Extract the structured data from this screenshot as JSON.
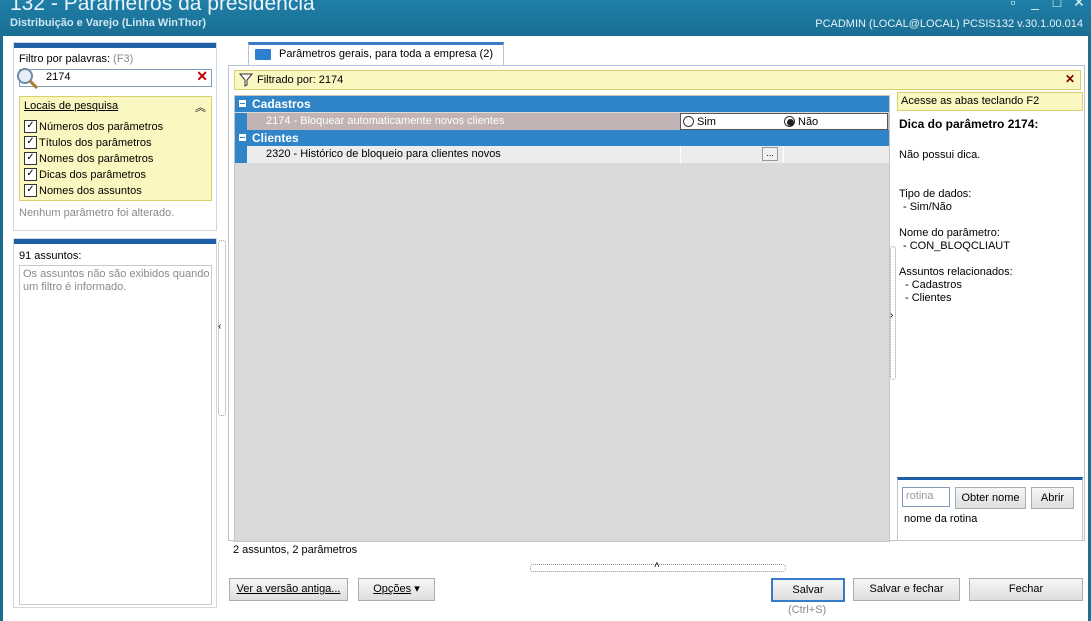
{
  "window": {
    "title": "132 - Parâmetros da presidência",
    "subtitle": "Distribuição e Varejo (Linha WinThor)",
    "user_info": "PCADMIN (LOCAL@LOCAL)   PCSIS132  v.30.1.00.014"
  },
  "filter": {
    "label": "Filtro por palavras:",
    "shortcut": "(F3)",
    "value": "2174",
    "locations_title": "Locais de pesquisa",
    "locations": [
      {
        "label": "Números dos parâmetros",
        "checked": true
      },
      {
        "label": "Títulos dos parâmetros",
        "checked": true
      },
      {
        "label": "Nomes dos parâmetros",
        "checked": true
      },
      {
        "label": "Dicas dos parâmetros",
        "checked": true
      },
      {
        "label": "Nomes dos assuntos",
        "checked": true
      }
    ],
    "no_change": "Nenhum parâmetro foi alterado."
  },
  "subjects": {
    "count": "91 assuntos:",
    "message": "Os assuntos não são exibidos quando um filtro é informado."
  },
  "tab": {
    "label": "Parâmetros gerais, para toda a empresa  (2)"
  },
  "filter_bar": {
    "label": "Filtrado por: 2174"
  },
  "grid": {
    "groups": [
      {
        "name": "Cadastros"
      },
      {
        "name": "Clientes"
      }
    ],
    "rows": [
      {
        "label": "2174 - Bloquear automaticamente novos clientes",
        "options": [
          "Sim",
          "Não"
        ],
        "selected": "Não"
      },
      {
        "label": "2320 - Histórico de bloqueio para clientes novos",
        "button": "..."
      }
    ]
  },
  "status": "2 assuntos, 2 parâmetros",
  "tip": {
    "hint": "Acesse as abas teclando F2",
    "title": "Dica do parâmetro 2174:",
    "text": "Não possui dica.",
    "type_label": "Tipo de dados:",
    "type_value": "- Sim/Não",
    "name_label": "Nome do parâmetro:",
    "name_value": "- CON_BLOQCLIAUT",
    "subjects_label": "Assuntos relacionados:",
    "subjects": [
      "- Cadastros",
      "- Clientes"
    ]
  },
  "routine": {
    "placeholder": "rotina",
    "get_name": "Obter nome",
    "open": "Abrir",
    "label": "nome da rotina"
  },
  "footer": {
    "old_version": "Ver a versão antiga...",
    "options": "Opções",
    "save": "Salvar",
    "save_shortcut": "(Ctrl+S)",
    "save_close": "Salvar e fechar",
    "close": "Fechar"
  }
}
